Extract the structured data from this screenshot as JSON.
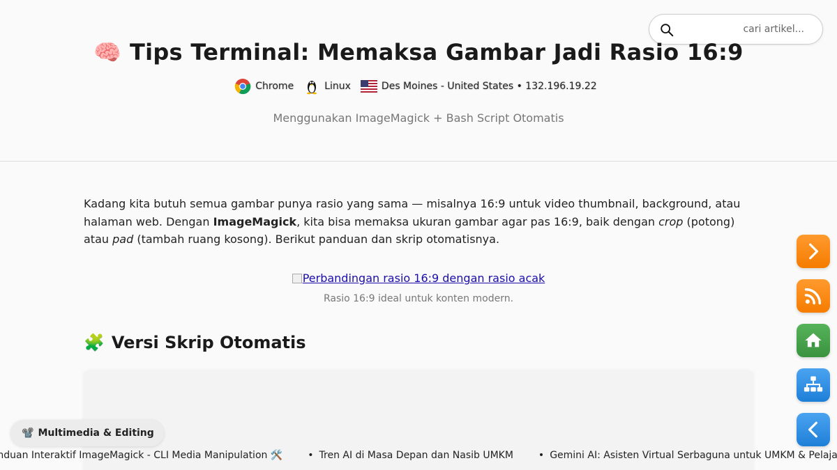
{
  "header": {
    "title": "Tips Terminal: Memaksa Gambar Jadi Rasio 16:9",
    "title_icon": "brain-emoji",
    "meta": {
      "browser": "Chrome",
      "os": "Linux",
      "location": "Des Moines - United States • 132.196.19.22"
    },
    "subtitle": "Menggunakan ImageMagick + Bash Script Otomatis"
  },
  "search": {
    "placeholder": "cari artikel..."
  },
  "article": {
    "intro_1": "Kadang kita butuh semua gambar punya rasio yang sama — misalnya 16:9 untuk video thumbnail, background, atau halaman web. Dengan ",
    "intro_bold": "ImageMagick",
    "intro_2": ", kita bisa memaksa ukuran gambar agar pas 16:9, baik dengan ",
    "intro_em1": "crop",
    "intro_3": " (potong) atau ",
    "intro_em2": "pad",
    "intro_4": " (tambah ruang kosong). Berikut panduan dan skrip otomatisnya.",
    "image_alt": "Perbandingan rasio 16:9 dengan rasio acak",
    "image_caption": "Rasio 16:9 ideal untuk konten modern.",
    "section_title": "Versi Skrip Otomatis"
  },
  "category_chip": {
    "icon": "film-projector-emoji",
    "label": "Multimedia & Editing"
  },
  "ticker": [
    "Panduan Interaktif ImageMagick - CLI Media Manipulation 🛠️",
    "Tren AI di Masa Depan dan Nasib UMKM",
    "Gemini AI: Asisten Virtual Serbaguna untuk UMKM & Pelajar"
  ],
  "side_buttons": [
    "next-arrow-icon",
    "rss-icon",
    "home-icon",
    "sitemap-icon",
    "back-arrow-icon"
  ],
  "colors": {
    "orange": "#f57c00",
    "green": "#3a933f",
    "blue": "#1e7fd8"
  }
}
